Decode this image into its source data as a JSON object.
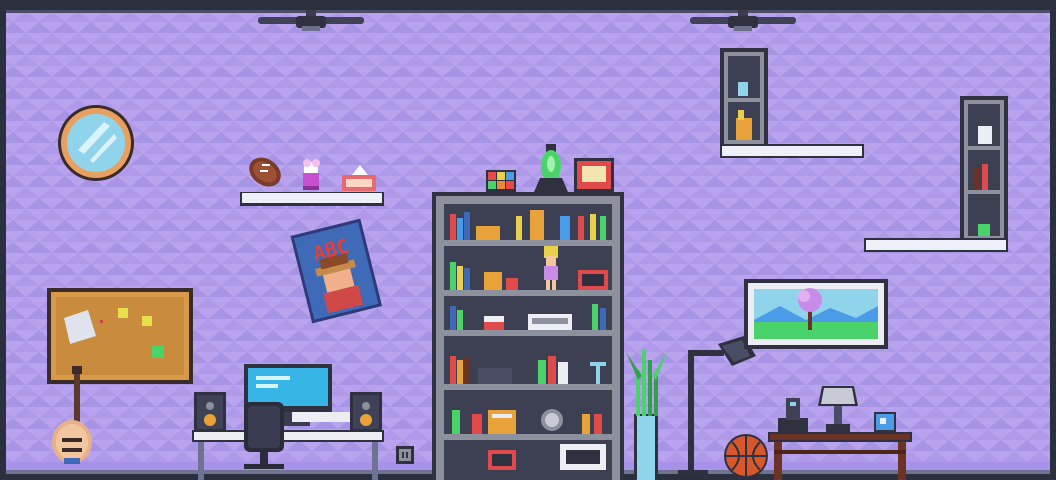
{
  "scene": {
    "room_type": "pixel-art bedroom interior",
    "colors": {
      "wall": "#b9a3ee",
      "wall_pattern": "#a58ee0",
      "frame": "#353847",
      "shelf": "#eef0f8",
      "bookcase_frame": "#8d919e",
      "bookcase_inner": "#3d4052",
      "cork": "#d79a48",
      "desk_top": "#eceef4",
      "monitor_screen": "#36b5e6",
      "table_wood": "#6b3326",
      "basketball": "#d8572a"
    },
    "poster": {
      "text": "ABC",
      "text_color": "#e0413b"
    },
    "objects": [
      "ceiling-fan-left",
      "ceiling-fan-right",
      "round-mirror",
      "wall-shelf-left",
      "football",
      "flower-vase",
      "tissue-box",
      "abc-poster",
      "cork-board",
      "electric-guitar",
      "computer-desk",
      "monitor",
      "speaker-left",
      "speaker-right",
      "office-chair",
      "wall-outlet",
      "bookcase",
      "rubiks-cube",
      "lava-lamp",
      "retro-tv",
      "doll-figure",
      "trophy",
      "plant",
      "floor-lamp",
      "landscape-painting",
      "basketball",
      "side-table",
      "table-lamp",
      "telephone",
      "mug",
      "wall-cabinet-top",
      "wall-cabinet-right"
    ]
  }
}
